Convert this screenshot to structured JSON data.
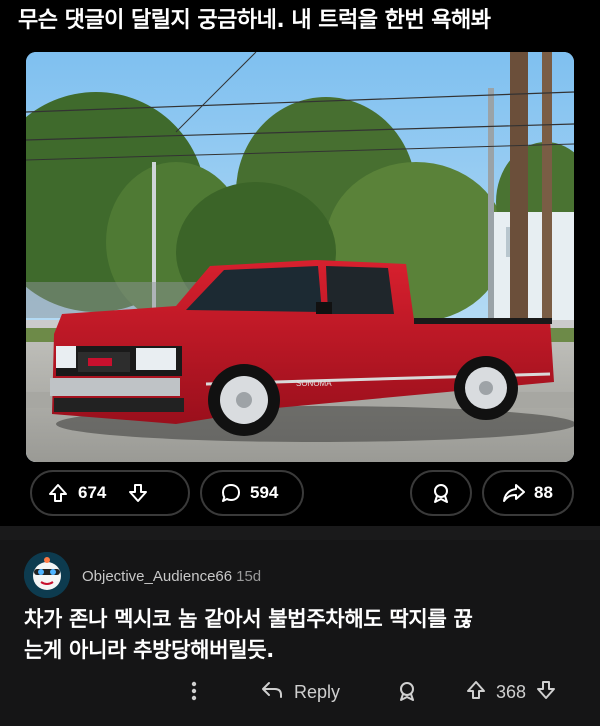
{
  "post": {
    "title": "무슨 댓글이 달릴지 궁금하네. 내 트럭을 한번 욕해봐",
    "image": {
      "description_icon": "red-pickup-truck-photo",
      "tailgate_text": "SONOMA"
    },
    "upvotes": "674",
    "comments": "594",
    "shares": "88"
  },
  "comment": {
    "author": "Objective_Audience66",
    "age": "15d",
    "line1": "차가 존나 멕시코 놈 같아서 불법주차해도 딱지를 끊",
    "line2": "는게 아니라 추방당해버릴듯.",
    "reply_label": "Reply",
    "upvotes": "368"
  },
  "colors": {
    "background": "#000000",
    "comment_bg": "#151516",
    "pill_border": "#3a3a3a",
    "truck_red": "#c8102e"
  }
}
